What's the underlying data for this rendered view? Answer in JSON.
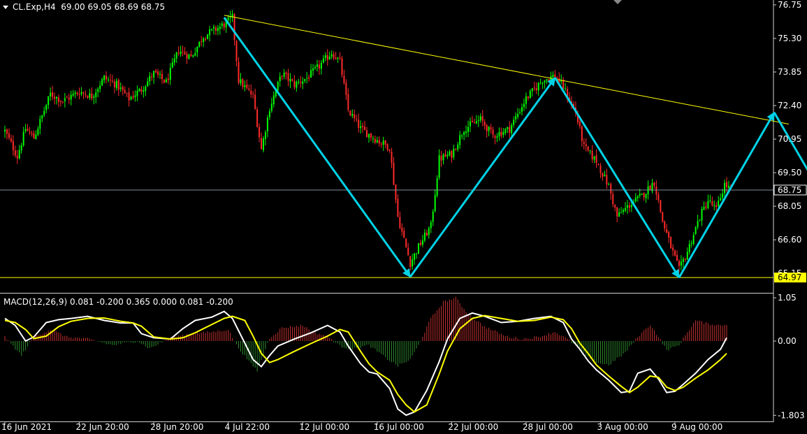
{
  "header": {
    "symbol": "CL.Exp,H4",
    "ohlc": "69.00 69.05 68.69 68.75",
    "macd_title": "MACD(12,26,9) 0.081 -0.200 0.365 0.000 0.081 -0.200"
  },
  "colors": {
    "background": "#000000",
    "bull": "#00ff00",
    "bear": "#ff2a2a",
    "trend_line": "#ffff00",
    "pattern_arrow": "#00d2e6",
    "signal_line": "#ffff00",
    "macd_line": "#ffffff",
    "hist_pos": "#c83232",
    "hist_neg": "#2e8b2e"
  },
  "chart_data": [
    {
      "type": "candlestick",
      "title": "CL.Exp,H4",
      "ylim": [
        64.4,
        76.9
      ],
      "yticks": [
        76.75,
        75.3,
        73.85,
        72.4,
        70.95,
        69.5,
        68.05,
        66.6,
        65.15
      ],
      "yticks_labels": [
        "76.75",
        "75.30",
        "73.85",
        "72.40",
        "70.95",
        "69.50",
        "68.05",
        "66.60",
        "65.15"
      ],
      "current_price": 68.75,
      "current_price_label": "68.75",
      "support_level": 64.97,
      "support_label": "64.97",
      "xlabels": [
        "16 Jun 2021",
        "22 Jun 20:00",
        "28 Jun 20:00",
        "4 Jul 22:00",
        "12 Jul 00:00",
        "16 Jul 00:00",
        "22 Jul 00:00",
        "28 Jul 00:00",
        "3 Aug 00:00",
        "9 Aug 00:00"
      ],
      "xlabel_index": [
        0,
        36,
        72,
        108,
        144,
        180,
        216,
        252,
        288,
        324
      ],
      "n_bars": 352,
      "anchors": [
        [
          0,
          71.3
        ],
        [
          6,
          70.2
        ],
        [
          10,
          71.4
        ],
        [
          14,
          71.0
        ],
        [
          22,
          72.9
        ],
        [
          28,
          72.6
        ],
        [
          36,
          73.0
        ],
        [
          42,
          72.8
        ],
        [
          48,
          73.6
        ],
        [
          54,
          73.3
        ],
        [
          60,
          72.7
        ],
        [
          66,
          73.1
        ],
        [
          72,
          73.8
        ],
        [
          78,
          73.4
        ],
        [
          84,
          74.8
        ],
        [
          90,
          74.5
        ],
        [
          96,
          75.4
        ],
        [
          100,
          75.6
        ],
        [
          106,
          75.9
        ],
        [
          110,
          76.2
        ],
        [
          113,
          73.5
        ],
        [
          120,
          72.8
        ],
        [
          124,
          70.5
        ],
        [
          128,
          72.3
        ],
        [
          134,
          73.8
        ],
        [
          140,
          73.3
        ],
        [
          146,
          73.6
        ],
        [
          152,
          74.1
        ],
        [
          158,
          74.7
        ],
        [
          162,
          74.3
        ],
        [
          166,
          72.2
        ],
        [
          172,
          71.4
        ],
        [
          180,
          70.9
        ],
        [
          186,
          70.6
        ],
        [
          190,
          67.6
        ],
        [
          196,
          65.6
        ],
        [
          200,
          66.3
        ],
        [
          206,
          67.2
        ],
        [
          210,
          70.1
        ],
        [
          216,
          70.3
        ],
        [
          222,
          71.4
        ],
        [
          230,
          71.8
        ],
        [
          236,
          71.1
        ],
        [
          244,
          71.4
        ],
        [
          252,
          72.7
        ],
        [
          260,
          73.5
        ],
        [
          266,
          73.7
        ],
        [
          270,
          73.2
        ],
        [
          276,
          72.1
        ],
        [
          280,
          70.6
        ],
        [
          286,
          70.0
        ],
        [
          292,
          68.9
        ],
        [
          296,
          67.6
        ],
        [
          302,
          68.1
        ],
        [
          308,
          68.5
        ],
        [
          314,
          69.1
        ],
        [
          318,
          67.4
        ],
        [
          322,
          66.3
        ],
        [
          326,
          65.3
        ],
        [
          330,
          66.1
        ],
        [
          336,
          67.6
        ],
        [
          340,
          68.3
        ],
        [
          344,
          67.9
        ],
        [
          348,
          69.0
        ],
        [
          351,
          68.75
        ]
      ]
    },
    {
      "type": "line",
      "title": "MACD(12,26,9)",
      "ylim": [
        -1.9,
        1.12
      ],
      "yticks": [
        1.05,
        0.0,
        -1.803
      ],
      "yticks_labels": [
        "1.05",
        "0.00",
        "-1.803"
      ],
      "series": [
        {
          "color": "#ffffff",
          "x": [
            0,
            5,
            10,
            14,
            20,
            26,
            32,
            40,
            48,
            56,
            62,
            66,
            72,
            80,
            86,
            92,
            100,
            106,
            110,
            116,
            120,
            124,
            128,
            132,
            140,
            148,
            156,
            162,
            166,
            172,
            176,
            180,
            186,
            190,
            194,
            198,
            204,
            210,
            214,
            220,
            226,
            232,
            240,
            248,
            256,
            264,
            270,
            274,
            278,
            282,
            286,
            292,
            298,
            302,
            306,
            312,
            316,
            320,
            324,
            328,
            334,
            340,
            346,
            349
          ],
          "values": [
            0.55,
            0.38,
            0.0,
            0.1,
            0.45,
            0.52,
            0.55,
            0.6,
            0.5,
            0.44,
            0.44,
            0.18,
            0.08,
            0.05,
            0.3,
            0.5,
            0.58,
            0.72,
            0.55,
            -0.05,
            -0.45,
            -0.62,
            -0.35,
            -0.12,
            0.05,
            0.2,
            0.38,
            0.22,
            -0.12,
            -0.55,
            -0.75,
            -0.8,
            -1.15,
            -1.65,
            -1.8,
            -1.72,
            -1.2,
            -0.5,
            0.05,
            0.55,
            0.68,
            0.6,
            0.45,
            0.48,
            0.55,
            0.6,
            0.45,
            0.05,
            -0.2,
            -0.48,
            -0.7,
            -0.95,
            -1.25,
            -1.22,
            -0.78,
            -0.68,
            -0.92,
            -1.25,
            -1.22,
            -1.05,
            -0.78,
            -0.45,
            -0.2,
            0.08
          ]
        },
        {
          "color": "#ffff00",
          "x": [
            0,
            5,
            10,
            14,
            20,
            26,
            32,
            40,
            48,
            56,
            62,
            66,
            72,
            80,
            86,
            92,
            100,
            106,
            110,
            116,
            120,
            124,
            128,
            132,
            140,
            148,
            156,
            162,
            166,
            172,
            176,
            180,
            186,
            190,
            194,
            198,
            204,
            210,
            214,
            220,
            226,
            232,
            240,
            248,
            256,
            264,
            270,
            274,
            278,
            282,
            286,
            292,
            298,
            302,
            306,
            312,
            316,
            320,
            324,
            328,
            334,
            340,
            346,
            349
          ],
          "values": [
            0.5,
            0.45,
            0.28,
            0.06,
            0.12,
            0.35,
            0.48,
            0.55,
            0.56,
            0.48,
            0.44,
            0.36,
            0.1,
            0.05,
            0.08,
            0.2,
            0.4,
            0.55,
            0.6,
            0.5,
            0.12,
            -0.3,
            -0.52,
            -0.45,
            -0.25,
            -0.06,
            0.12,
            0.28,
            0.22,
            -0.25,
            -0.55,
            -0.75,
            -0.95,
            -1.3,
            -1.55,
            -1.72,
            -1.55,
            -0.8,
            -0.25,
            0.3,
            0.55,
            0.62,
            0.55,
            0.48,
            0.5,
            0.58,
            0.52,
            0.3,
            -0.05,
            -0.3,
            -0.58,
            -0.85,
            -1.1,
            -1.25,
            -1.12,
            -0.85,
            -0.88,
            -1.12,
            -1.2,
            -1.12,
            -0.9,
            -0.7,
            -0.45,
            -0.3
          ]
        }
      ],
      "histogram_anchors": [
        [
          0,
          0.1
        ],
        [
          8,
          -0.35
        ],
        [
          14,
          0.1
        ],
        [
          22,
          0.28
        ],
        [
          30,
          0.1
        ],
        [
          40,
          0.05
        ],
        [
          52,
          -0.1
        ],
        [
          64,
          0.0
        ],
        [
          70,
          -0.18
        ],
        [
          80,
          0.08
        ],
        [
          90,
          0.18
        ],
        [
          100,
          0.22
        ],
        [
          108,
          0.28
        ],
        [
          112,
          -0.1
        ],
        [
          118,
          -0.5
        ],
        [
          122,
          -0.72
        ],
        [
          128,
          0.08
        ],
        [
          134,
          0.32
        ],
        [
          144,
          0.38
        ],
        [
          150,
          0.2
        ],
        [
          156,
          0.12
        ],
        [
          162,
          -0.12
        ],
        [
          168,
          -0.2
        ],
        [
          176,
          -0.1
        ],
        [
          184,
          -0.4
        ],
        [
          190,
          -0.6
        ],
        [
          196,
          -0.45
        ],
        [
          200,
          -0.1
        ],
        [
          206,
          0.55
        ],
        [
          212,
          0.95
        ],
        [
          218,
          1.05
        ],
        [
          224,
          0.65
        ],
        [
          232,
          0.35
        ],
        [
          242,
          0.12
        ],
        [
          250,
          0.05
        ],
        [
          258,
          0.1
        ],
        [
          266,
          0.22
        ],
        [
          272,
          0.05
        ],
        [
          278,
          -0.2
        ],
        [
          284,
          -0.5
        ],
        [
          292,
          -0.58
        ],
        [
          300,
          -0.28
        ],
        [
          306,
          0.1
        ],
        [
          312,
          0.4
        ],
        [
          316,
          0.1
        ],
        [
          320,
          -0.22
        ],
        [
          326,
          -0.1
        ],
        [
          330,
          0.22
        ],
        [
          334,
          0.5
        ],
        [
          340,
          0.42
        ],
        [
          346,
          0.38
        ],
        [
          349,
          0.4
        ]
      ]
    }
  ],
  "annotations": {
    "trend_line": [
      [
        106,
        76.3
      ],
      [
        379,
        71.6
      ]
    ],
    "pattern_arrows": [
      [
        [
          106,
          76.2
        ],
        [
          196,
          65.0
        ]
      ],
      [
        [
          196,
          65.0
        ],
        [
          266,
          73.6
        ]
      ],
      [
        [
          266,
          73.6
        ],
        [
          326,
          64.97
        ]
      ],
      [
        [
          326,
          64.97
        ],
        [
          372,
          72.1
        ]
      ],
      [
        [
          372,
          72.1
        ],
        [
          416,
          65.35
        ]
      ]
    ]
  }
}
